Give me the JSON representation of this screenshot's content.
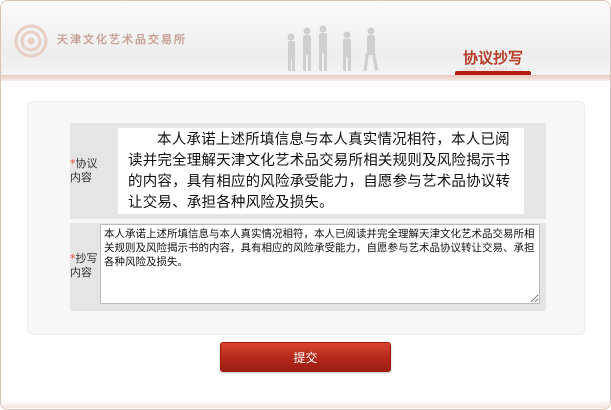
{
  "header": {
    "logo_text": "天津文化艺术品交易所",
    "page_title": "协议抄写"
  },
  "agreement": {
    "label_required_mark": "*",
    "label": "协议内容",
    "text": "本人承诺上述所填信息与本人真实情况相符，本人已阅读并完全理解天津文化艺术品交易所相关规则及风险揭示书的内容，具有相应的风险承受能力，自愿参与艺术品协议转让交易、承担各种风险及损失。"
  },
  "copy": {
    "label_required_mark": "*",
    "label": "抄写内容",
    "value": "本人承诺上述所填信息与本人真实情况相符，本人已阅读并完全理解天津文化艺术品交易所相关规则及风险揭示书的内容，具有相应的风险承受能力，自愿参与艺术品协议转让交易、承担各种风险及损失。"
  },
  "actions": {
    "submit_label": "提交"
  },
  "colors": {
    "accent": "#b41e12",
    "required": "#e6483c",
    "title": "#b63b26"
  }
}
